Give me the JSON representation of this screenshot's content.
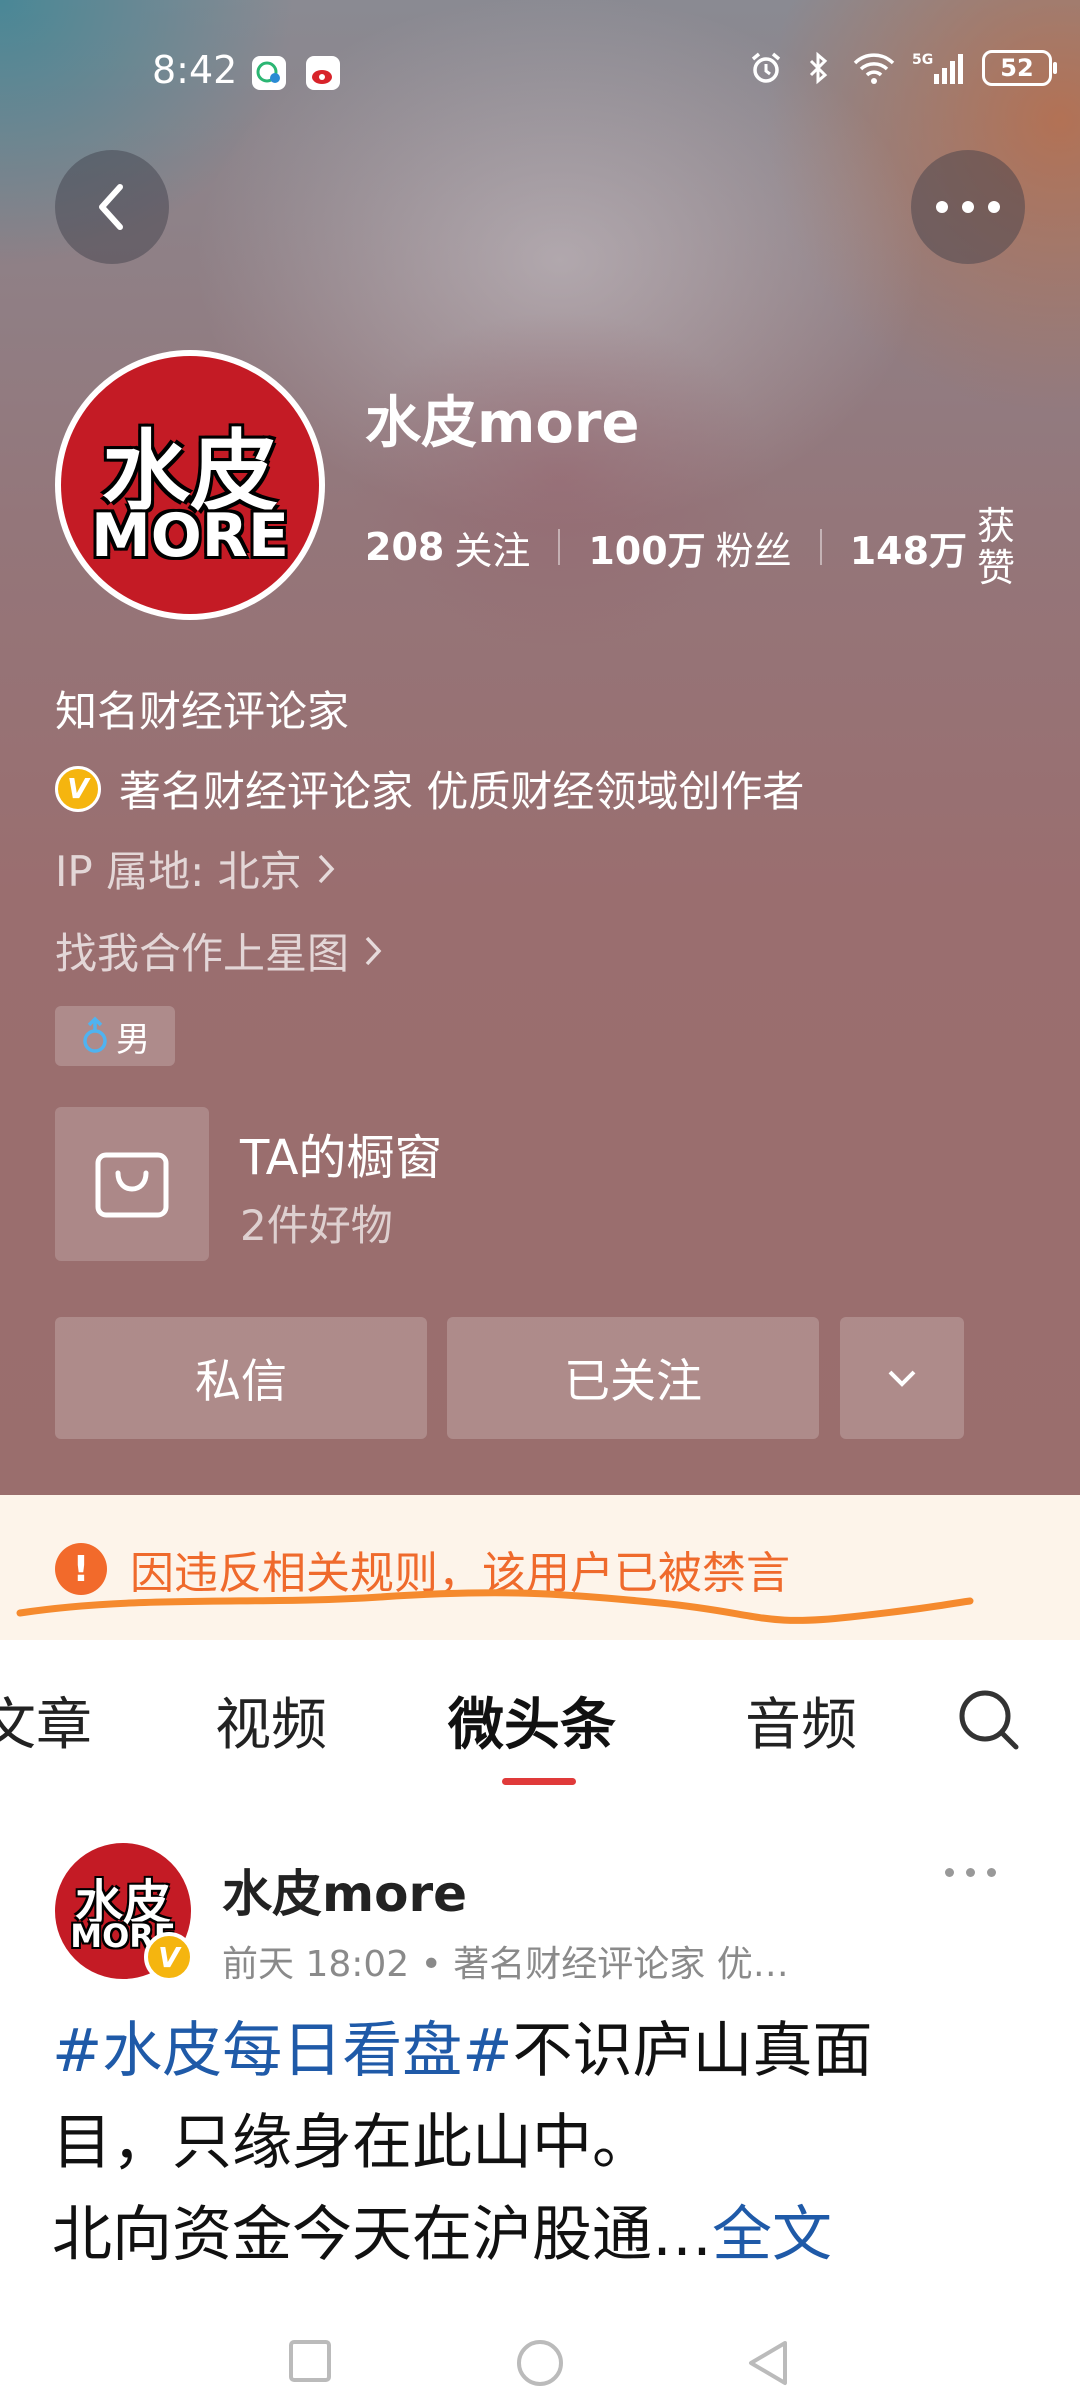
{
  "status_bar": {
    "time": "8:42",
    "battery": "52"
  },
  "profile": {
    "name": "水皮more",
    "avatar_text_top": "水皮",
    "avatar_text_bottom": "MORE",
    "stats": [
      {
        "num": "208",
        "label": "关注"
      },
      {
        "num": "100万",
        "label": "粉丝"
      },
      {
        "num": "148万",
        "label": "获赞"
      }
    ],
    "bio": "知名财经评论家",
    "verified_text": "著名财经评论家 优质财经领域创作者",
    "ip_location": "IP 属地: 北京",
    "star_map_link": "找我合作上星图",
    "gender": "男",
    "shop": {
      "title": "TA的橱窗",
      "subtitle": "2件好物"
    },
    "buttons": {
      "message": "私信",
      "followed": "已关注"
    }
  },
  "notice": {
    "text": "因违反相关规则，该用户已被禁言"
  },
  "tabs": [
    {
      "label": "文章",
      "active": false
    },
    {
      "label": "视频",
      "active": false
    },
    {
      "label": "微头条",
      "active": true
    },
    {
      "label": "音频",
      "active": false
    }
  ],
  "post": {
    "author": "水皮more",
    "verified_badge": "V",
    "meta": "前天  18:02 • 著名财经评论家 优…",
    "hashtag": "#水皮每日看盘#",
    "body_line1_rest": "不识庐山真面",
    "body_line2": "目，只缘身在此山中。",
    "body_line3": "北向资金今天在沪股通…",
    "full_text_link": "全文"
  },
  "colors": {
    "notice_orange": "#ef6a2c",
    "link_blue": "#1f5aa8",
    "tab_indicator": "#e03a3a",
    "badge_gold": "#f5b50f"
  }
}
